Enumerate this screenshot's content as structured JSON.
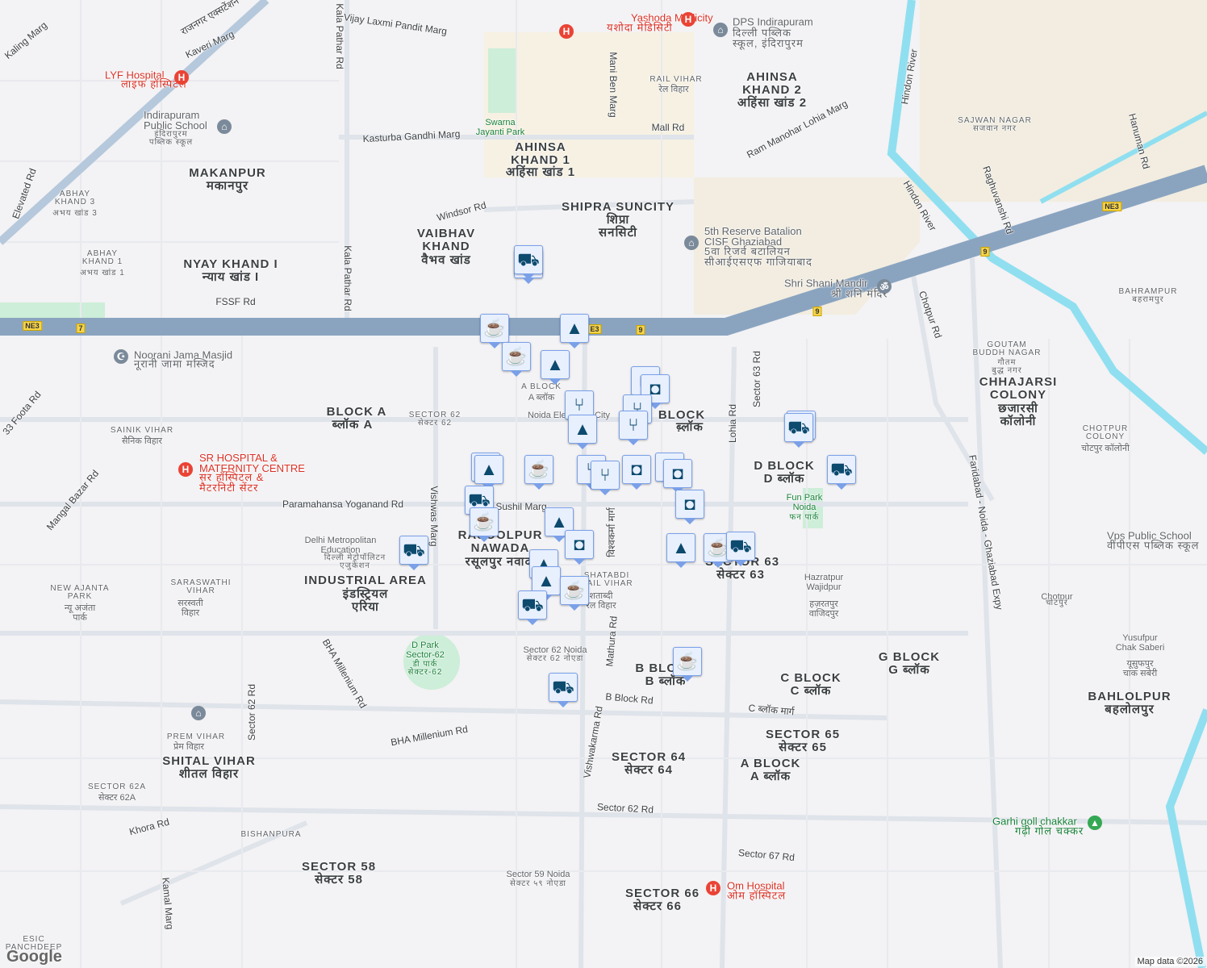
{
  "labels": {
    "yashoda": "Yashoda Medicity",
    "yashoda_hi": "यशोदा मेडिसिटी",
    "lyf": "LYF Hospital",
    "lyf_hi": "लाइफ हॉस्पिटल",
    "sr": "SR HOSPITAL &\nMATERNITY CENTRE",
    "sr_hi": "सर हॉस्पिटल &\nमैटरनिटी सेंटर",
    "om": "Om Hospital",
    "om_hi": "ओम हॉस्पिटल",
    "dps": "DPS Indirapuram",
    "dps_hi": "दिल्ली पब्लिक\nस्कूल, इंदिरापुरम",
    "ips": "Indirapuram\nPublic School",
    "ips_hi": "इंदिरापुरम\nपब्लिक स्कूल",
    "makanpur": "MAKANPUR",
    "makanpur_hi": "मकानपुर",
    "abhay3": "ABHAY\nKHAND 3",
    "abhay3_hi": "अभय खांड 3",
    "abhay1": "ABHAY\nKHAND 1",
    "abhay1_hi": "अभय खांड 1",
    "nyay": "NYAY KHAND I",
    "nyay_hi": "न्याय खांड I",
    "vaibhav": "VAIBHAV\nKHAND",
    "vaibhav_hi": "वैभव खांड",
    "ahinsa1": "AHINSA\nKHAND 1",
    "ahinsa1_hi": "अहिंसा खांड 1",
    "ahinsa2": "AHINSA\nKHAND 2",
    "ahinsa2_hi": "अहिंसा खांड 2",
    "shipra": "SHIPRA SUNCITY",
    "shipra_hi": "शिप्रा\nसनसिटी",
    "railvihar": "RAIL VIHAR",
    "railvihar_hi": "रेल विहार",
    "cisf": "5th Reserve Batalion\nCISF Ghaziabad",
    "cisf_hi": "5वा रिजर्व बटालियन\nसीआईएसएफ गाजियाबाद",
    "shani": "Shri Shani Mandir",
    "shani_hi": "श्री शनि मंदिर",
    "chhajarsi": "CHHAJARSI\nCOLONY",
    "chhajarsi_hi": "छजारसी\nकॉलोनी",
    "chotpur_col": "CHOTPUR\nCOLONY",
    "chotpur_col_hi": "चोटपुर कॉलोनी",
    "bahrampur": "BAHRAMPUR",
    "bahrampur_hi": "बहरामपुर",
    "noorani": "Noorani Jama Masjid",
    "noorani_hi": "नूरानी जामा मस्जिद",
    "blocka": "BLOCK A",
    "blocka_hi": "ब्लॉक A",
    "sainik": "SAINIK VIHAR",
    "sainik_hi": "सैनिक विहार",
    "sector62": "SECTOR 62",
    "sector62_hi": "सेक्टर 62",
    "ablock": "A BLOCK",
    "ablock_hi": "A ब्लॉक",
    "hblock": "BLOCK\nH",
    "hblock_hi": "ब्लॉक",
    "noidaelec": "Noida Electronic City",
    "rasoolpur": "RASOOLPUR\nNAWADA",
    "rasoolpur_hi": "रसूलपुर नवादा",
    "industrial": "INDUSTRIAL AREA",
    "industrial_hi": "इंडस्ट्रियल\nएरिया",
    "metro_edu": "Delhi Metropolitan\nEducation",
    "metro_edu_hi": "दिल्ली मेट्रोपॉलिटन\nएजुकेशन",
    "shatabdi": "SHATABDI\nRAIL VIHAR",
    "shatabdi_hi": "शताब्दी\nरेल विहार",
    "sector63": "SECTOR 63",
    "sector63_hi": "सेक्टर 63",
    "dblock": "D BLOCK",
    "dblock_hi": "D ब्लॉक",
    "funpark": "Fun Park\nNoida",
    "funpark_hi": "फन पार्क",
    "hazratpur": "Hazratpur\nWajidpur",
    "hazratpur_hi": "हज़रतपुर\nवाजिदपुर",
    "chotpur": "Chotpur",
    "chotpur_hi": "चोटपुर",
    "yusufpur": "Yusufpur\nChak Saberi",
    "yusufpur_hi": "यूसुफपुर\nचाक सबेरी",
    "bahlolpur": "BAHLOLPUR",
    "bahlolpur_hi": "बहलोलपुर",
    "vps": "Vps Public School",
    "vps_hi": "वीपीएस पब्लिक स्कूल",
    "gblock": "G BLOCK",
    "gblock_hi": "G ब्लॉक",
    "cblock": "C BLOCK",
    "cblock_hi": "C ब्लॉक",
    "bblock": "B BLOCK",
    "bblock_hi": "B ब्लॉक",
    "sector65": "SECTOR 65",
    "sector65_hi": "सेक्टर 65",
    "sector64": "SECTOR 64",
    "sector64_hi": "सेक्टर 64",
    "ablock2": "A BLOCK",
    "ablock2_hi": "A ब्लॉक",
    "dpark": "D Park\nSector-62",
    "dpark_hi": "डी पार्क\nसेक्टर-62",
    "s62noida": "Sector 62 Noida",
    "s62noida_hi": "सेक्टर 62 नोएडा",
    "newajanta": "NEW AJANTA\nPARK",
    "newajanta_hi": "न्यू अजंता\nपार्क",
    "saraswathi": "SARASWATHI\nVIHAR",
    "saraswathi_hi": "सरस्वती\nविहार",
    "premvihar": "PREM VIHAR",
    "premvihar_hi": "प्रेम विहार",
    "shital": "SHITAL VIHAR",
    "shital_hi": "शीतल विहार",
    "sector62a": "SECTOR 62A",
    "sector62a_hi": "सेक्टर 62A",
    "sector58": "SECTOR 58",
    "sector58_hi": "सेक्टर 58",
    "sector66": "SECTOR 66",
    "sector66_hi": "सेक्टर 66",
    "s59noida": "Sector 59 Noida",
    "s59noida_hi": "सेक्टर ५९ नोएडा",
    "garhi": "Garhi goll chakkar",
    "garhi_hi": "गढ़ी गोल चक्कर",
    "swarna": "Swarna\nJayanti Park",
    "sajwan": "SAJWAN NAGAR",
    "sajwan_hi": "सजवान नगर",
    "goutam": "GOUTAM\nBUDDH NAGAR",
    "goutam_hi": "गौतम\nबुद्ध नगर",
    "bishanpura": "BISHANPURA",
    "esic": "ESIC\nPANCHDEEP"
  },
  "roads": {
    "vijay": "Vijay Laxmi Pandit Marg",
    "kaveri": "Kaveri Marg",
    "kaling": "Kaling Marg",
    "kasturba": "Kasturba Gandhi Marg",
    "windsor": "Windsor Rd",
    "fssf": "FSSF Rd",
    "kalapathar": "Kala Pathar Rd",
    "kalapathar2": "Kala Pathar Rd",
    "mall": "Mall Rd",
    "manibenmarg": "Mani Ben Marg",
    "rammanohar": "Ram Manohar Lohia Marg",
    "hindon": "Hindon River",
    "hindon2": "Hindon River",
    "chotpurrd": "Chotpur Rd",
    "sector63rd": "Sector 63 Rd",
    "lohia": "Lohia Rd",
    "paramahansa": "Paramahansa Yoganand Rd",
    "vishwas": "Vishwas Marg",
    "bha": "BHA Millenium Rd",
    "bha2": "BHA Millenium Rd",
    "sector62rd": "Sector 62 Rd",
    "bblockrd": "B Block Rd",
    "cblockmarg": "C ब्लॉक मार्ग",
    "vishwakarma": "Vishwakarma Rd",
    "mathura": "Mathura Rd",
    "sector62rd2": "Sector 62 Rd",
    "sector67rd": "Sector 67 Rd",
    "khora": "Khora Rd",
    "kamal": "Kamal Marg",
    "faridabad": "Faridabad - Noida - Ghaziabad Expy",
    "foota": "33 Foota Rd",
    "mangal": "Mangal Bazar Rd",
    "elevated": "Elevated Rd",
    "hanuman": "Hanuman Rd",
    "raghuvanshi": "Raghuvanshi Rd",
    "rajnagar": "राजनगर एक्सटेंशन",
    "sushil": "Sushil Marg",
    "vishwakarma_hi": "विश्वकर्मा मार्ग"
  },
  "shields": {
    "ne3": "NE3",
    "ne3b": "NE3",
    "ne3c": "E3",
    "n7": "7",
    "n9": "9",
    "n9b": "9",
    "n9c": "9"
  },
  "markers": [
    "shopping-cart",
    "shopping-cart",
    "coffee",
    "graduation-cap",
    "coffee",
    "graduation-cap",
    "shopping-bag",
    "shopping-bag",
    "restaurant",
    "restaurant",
    "restaurant",
    "graduation-cap",
    "shopping-cart",
    "shopping-cart",
    "graduation-cap",
    "coffee",
    "restaurant",
    "graduation-cap",
    "restaurant",
    "shopping-bag",
    "restaurant",
    "shopping-bag",
    "shopping-cart",
    "coffee",
    "graduation-cap",
    "shopping-bag",
    "shopping-bag",
    "shopping-cart",
    "graduation-cap",
    "coffee",
    "shopping-cart",
    "graduation-cap",
    "graduation-cap",
    "coffee",
    "shopping-cart",
    "shopping-cart",
    "coffee",
    "shopping-cart"
  ],
  "logo": "Google",
  "attribution": "Map data ©2026"
}
